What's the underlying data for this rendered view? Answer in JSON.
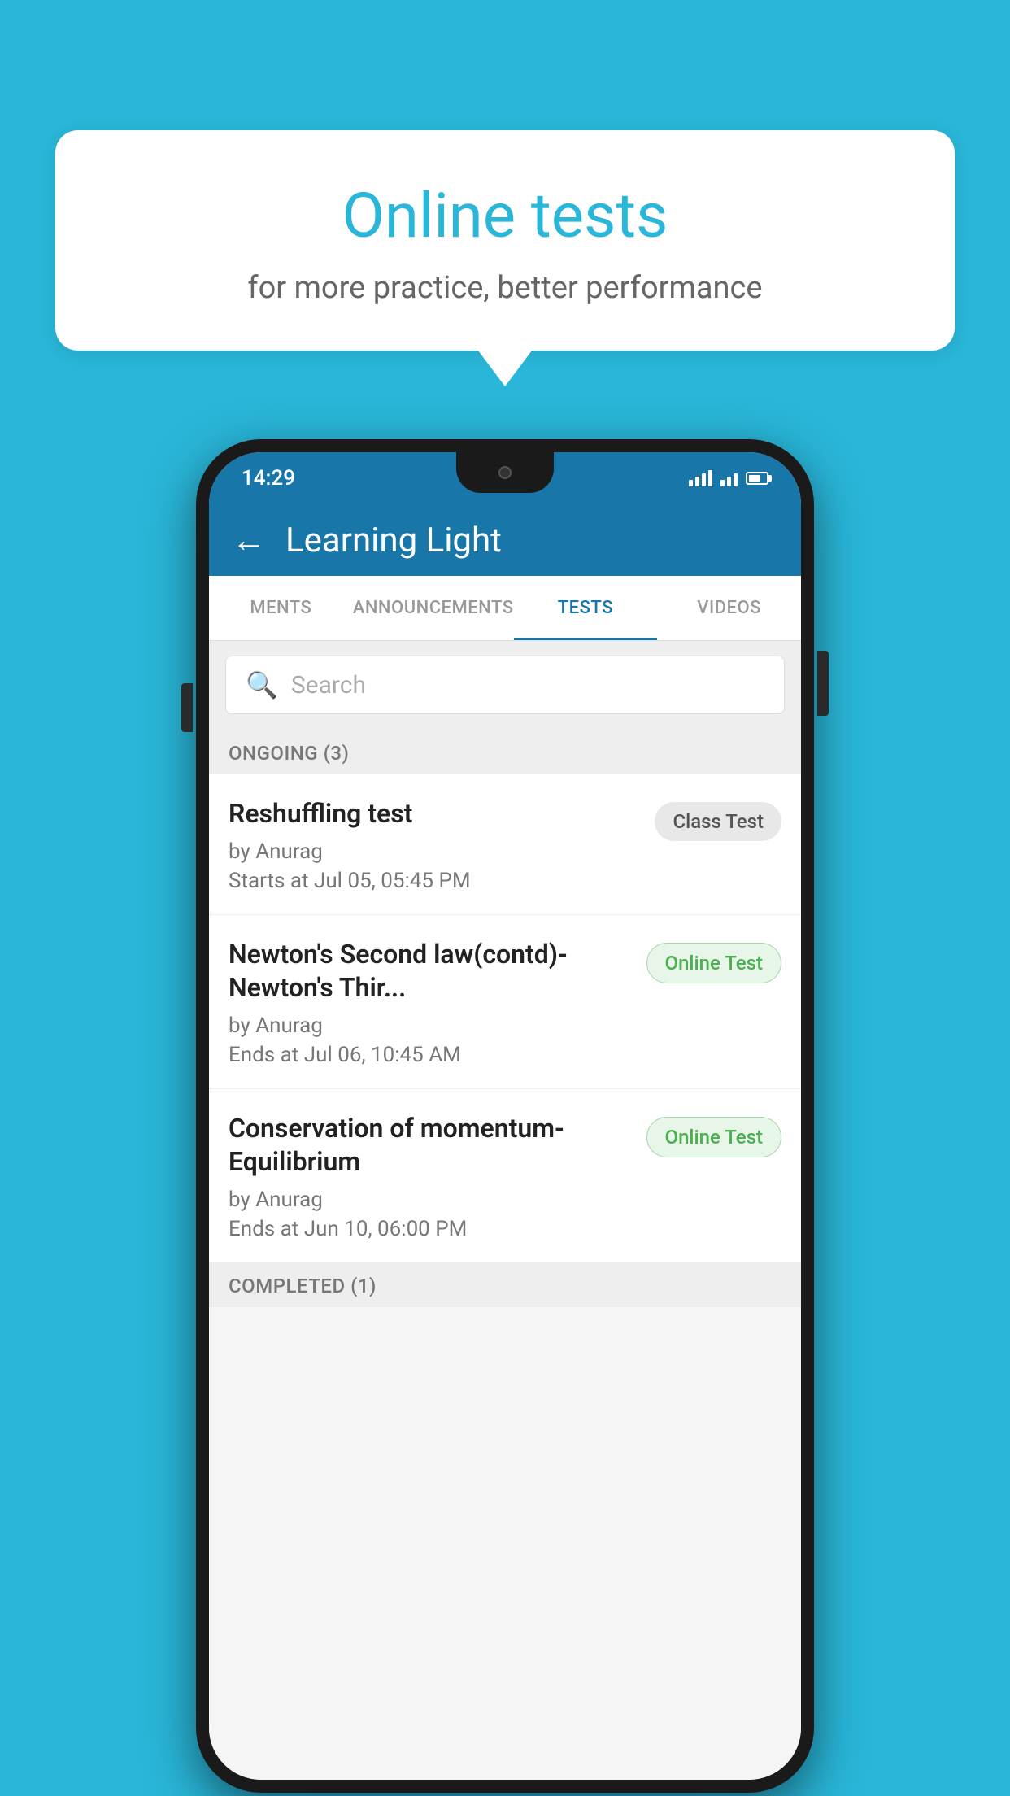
{
  "background_color": "#29b6d8",
  "bubble": {
    "title": "Online tests",
    "subtitle": "for more practice, better performance"
  },
  "phone": {
    "status_bar": {
      "time": "14:29"
    },
    "app_bar": {
      "title": "Learning Light",
      "back_label": "←"
    },
    "tabs": [
      {
        "label": "MENTS",
        "active": false
      },
      {
        "label": "ANNOUNCEMENTS",
        "active": false
      },
      {
        "label": "TESTS",
        "active": true
      },
      {
        "label": "VIDEOS",
        "active": false
      }
    ],
    "search": {
      "placeholder": "Search"
    },
    "sections": [
      {
        "title": "ONGOING (3)",
        "tests": [
          {
            "name": "Reshuffling test",
            "by": "by Anurag",
            "date": "Starts at  Jul 05, 05:45 PM",
            "badge": "Class Test",
            "badge_type": "class"
          },
          {
            "name": "Newton's Second law(contd)-Newton's Thir...",
            "by": "by Anurag",
            "date": "Ends at  Jul 06, 10:45 AM",
            "badge": "Online Test",
            "badge_type": "online"
          },
          {
            "name": "Conservation of momentum-Equilibrium",
            "by": "by Anurag",
            "date": "Ends at  Jun 10, 06:00 PM",
            "badge": "Online Test",
            "badge_type": "online"
          }
        ]
      },
      {
        "title": "COMPLETED (1)",
        "tests": []
      }
    ]
  }
}
